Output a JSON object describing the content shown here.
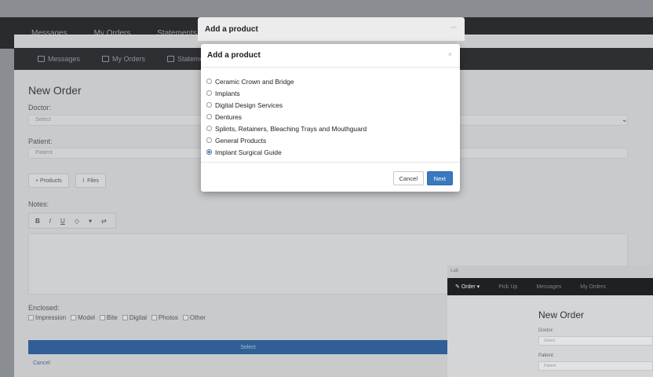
{
  "back_window": {
    "nav": [
      "Messages",
      "My Orders",
      "Statements"
    ],
    "modal_title": "Add a product"
  },
  "page": {
    "nav": [
      "Messages",
      "My Orders",
      "Statements"
    ],
    "title": "New Order",
    "doctor_label": "Doctor:",
    "doctor_placeholder": "Select",
    "patient_label": "Patient:",
    "patient_placeholder": "Patient",
    "products_button": "+ Products",
    "files_button": "Files",
    "notes_label": "Notes:",
    "toolbar": [
      "B",
      "I",
      "U",
      "◇",
      "▾",
      "⇄"
    ],
    "enclosed_label": "Enclosed:",
    "enclosed_items": [
      "Impression",
      "Model",
      "Bite",
      "Digital",
      "Photos",
      "Other"
    ],
    "select_button": "Select",
    "cancel_link": "Cancel"
  },
  "mini_page": {
    "top_text": "Lab",
    "nav": [
      "Order",
      "Pick Up",
      "Messages",
      "My Orders"
    ],
    "title": "New Order",
    "doctor_label": "Doctor:",
    "doctor_placeholder": "Select",
    "patient_label": "Patient:",
    "patient_placeholder": "Patient"
  },
  "modal": {
    "title": "Add a product",
    "close": "×",
    "options": [
      {
        "label": "Ceramic Crown and Bridge",
        "checked": false
      },
      {
        "label": "Implants",
        "checked": false
      },
      {
        "label": "Digital Design Services",
        "checked": false
      },
      {
        "label": "Dentures",
        "checked": false
      },
      {
        "label": "Splints, Retainers, Bleaching Trays and Mouthguard",
        "checked": false
      },
      {
        "label": "General Products",
        "checked": false
      },
      {
        "label": "Implant Surgical Guide",
        "checked": true
      }
    ],
    "cancel_label": "Cancel",
    "next_label": "Next"
  },
  "colors": {
    "primary": "#3a78bf",
    "navbar": "#2e2f32",
    "backdrop": "#8a8d91"
  }
}
